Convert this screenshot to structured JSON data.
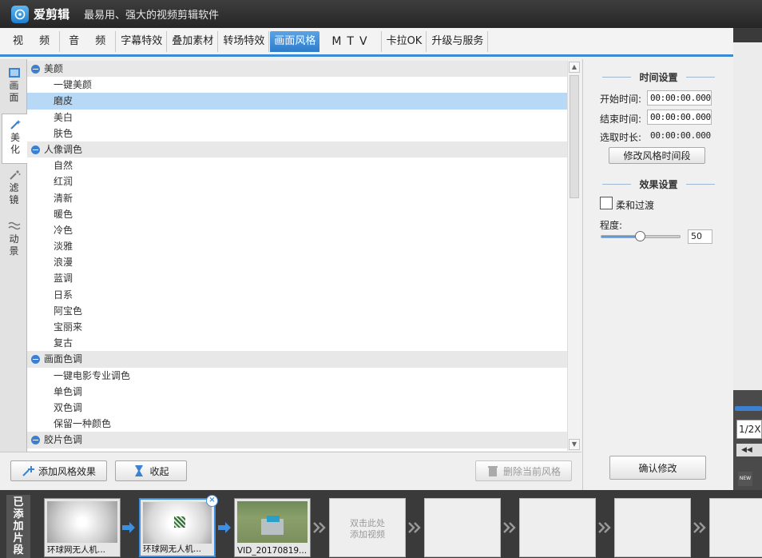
{
  "app": {
    "name": "爱剪辑",
    "slogan": "最易用、强大的视频剪辑软件"
  },
  "tabs": [
    {
      "label": "视 频"
    },
    {
      "label": "音 频"
    },
    {
      "label": "字幕特效"
    },
    {
      "label": "叠加素材"
    },
    {
      "label": "转场特效"
    },
    {
      "label": "画面风格",
      "active": true
    },
    {
      "label": "MTV"
    },
    {
      "label": "卡拉OK"
    },
    {
      "label": "升级与服务"
    }
  ],
  "side_tabs": [
    {
      "label1": "画",
      "label2": "面",
      "icon": "film-icon"
    },
    {
      "label1": "美",
      "label2": "化",
      "icon": "magic-wand-icon",
      "active": true
    },
    {
      "label1": "滤",
      "label2": "镜",
      "icon": "wand-sparkle-icon"
    },
    {
      "label1": "动",
      "label2": "景",
      "icon": "waves-icon"
    }
  ],
  "effect_list": [
    {
      "type": "group",
      "label": "美颜"
    },
    {
      "type": "item",
      "label": "一键美颜"
    },
    {
      "type": "item",
      "label": "磨皮",
      "selected": true
    },
    {
      "type": "item",
      "label": "美白"
    },
    {
      "type": "item",
      "label": "肤色"
    },
    {
      "type": "group",
      "label": "人像调色"
    },
    {
      "type": "item",
      "label": "自然"
    },
    {
      "type": "item",
      "label": "红润"
    },
    {
      "type": "item",
      "label": "清新"
    },
    {
      "type": "item",
      "label": "暖色"
    },
    {
      "type": "item",
      "label": "冷色"
    },
    {
      "type": "item",
      "label": "淡雅"
    },
    {
      "type": "item",
      "label": "浪漫"
    },
    {
      "type": "item",
      "label": "蓝调"
    },
    {
      "type": "item",
      "label": "日系"
    },
    {
      "type": "item",
      "label": "阿宝色"
    },
    {
      "type": "item",
      "label": "宝丽来"
    },
    {
      "type": "item",
      "label": "复古"
    },
    {
      "type": "group",
      "label": "画面色调"
    },
    {
      "type": "item",
      "label": "一键电影专业调色"
    },
    {
      "type": "item",
      "label": "单色调"
    },
    {
      "type": "item",
      "label": "双色调"
    },
    {
      "type": "item",
      "label": "保留一种颜色"
    },
    {
      "type": "group",
      "label": "胶片色调"
    }
  ],
  "actions": {
    "add_effect": "添加风格效果",
    "collect": "收起",
    "delete_current": "删除当前风格",
    "confirm": "确认修改"
  },
  "settings": {
    "time_title": "时间设置",
    "start_label": "开始时间:",
    "start_value": "00:00:00.000",
    "end_label": "结束时间:",
    "end_value": "00:00:00.000",
    "duration_label": "选取时长:",
    "duration_value": "00:00:00.000",
    "modify_segment": "修改风格时间段",
    "effect_title": "效果设置",
    "soft_transition": "柔和过渡",
    "soft_transition_checked": false,
    "degree_label": "程度:",
    "degree_value": "50",
    "degree_fraction": 0.5
  },
  "preview": {
    "speed": "1/2X"
  },
  "timeline": {
    "label1": "已",
    "label2": "添",
    "label3": "加",
    "label4": "片",
    "label5": "段",
    "clips": [
      {
        "caption": "环球网无人机..."
      },
      {
        "caption": "环球网无人机...",
        "selected": true
      },
      {
        "caption": "VID_20170819..."
      }
    ],
    "add_hint_line1": "双击此处",
    "add_hint_line2": "添加视频"
  },
  "colors": {
    "accent": "#3b8ad6",
    "selected_row": "#b8d9f5",
    "title_bar": "#2f2f2f"
  }
}
